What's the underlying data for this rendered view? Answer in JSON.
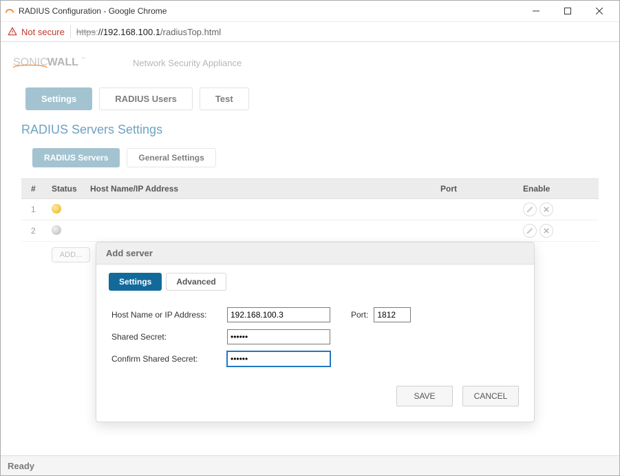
{
  "window": {
    "title": "RADIUS Configuration - Google Chrome"
  },
  "addressbar": {
    "not_secure": "Not secure",
    "proto": "https",
    "host": "//192.168.100.1",
    "path": "/radiusTop.html"
  },
  "brand": {
    "name": "SONICWALL",
    "subtitle": "Network Security Appliance"
  },
  "main_tabs": {
    "settings": "Settings",
    "radius_users": "RADIUS Users",
    "test": "Test"
  },
  "section_title": "RADIUS Servers Settings",
  "sub_tabs": {
    "radius_servers": "RADIUS Servers",
    "general_settings": "General Settings"
  },
  "table": {
    "headers": {
      "num": "#",
      "status": "Status",
      "host": "Host Name/IP Address",
      "port": "Port",
      "enable": "Enable"
    },
    "rows": [
      {
        "num": "1",
        "status": "yellow"
      },
      {
        "num": "2",
        "status": "gray"
      }
    ],
    "add_btn": "ADD..."
  },
  "modal": {
    "title": "Add server",
    "tabs": {
      "settings": "Settings",
      "advanced": "Advanced"
    },
    "labels": {
      "host": "Host Name or IP Address:",
      "port": "Port:",
      "secret": "Shared Secret:",
      "confirm_secret": "Confirm Shared Secret:"
    },
    "values": {
      "host": "192.168.100.3",
      "port": "1812",
      "secret": "••••••",
      "confirm_secret": "••••••"
    },
    "buttons": {
      "save": "SAVE",
      "cancel": "CANCEL"
    }
  },
  "statusbar": {
    "text": "Ready"
  }
}
